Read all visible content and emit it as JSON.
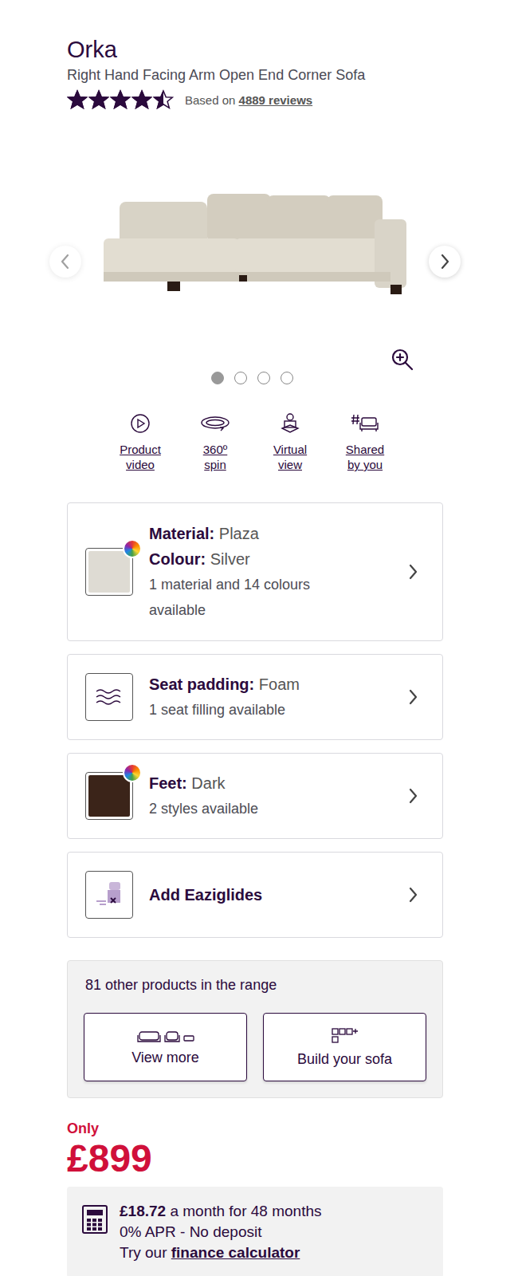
{
  "product": {
    "name": "Orka",
    "description": "Right Hand Facing Arm Open End Corner Sofa",
    "stars": 4.5,
    "reviews_prefix": "Based on",
    "reviews_link": "4889 reviews"
  },
  "gallery": {
    "slides": [
      {
        "selected": true
      },
      {
        "selected": false
      },
      {
        "selected": false
      },
      {
        "selected": false
      }
    ]
  },
  "media_links": [
    {
      "kind": "video",
      "lines": [
        "Product",
        "video"
      ]
    },
    {
      "kind": "spin",
      "lines": [
        "360º",
        "spin"
      ]
    },
    {
      "kind": "virtual",
      "lines": [
        "Virtual",
        "view"
      ]
    },
    {
      "kind": "shared",
      "lines": [
        "Shared",
        "by you"
      ]
    }
  ],
  "options": [
    {
      "kind": "swatch",
      "color": "#dedbd3",
      "fields": [
        {
          "label": "Material:",
          "value": "Plaza"
        },
        {
          "label": "Colour:",
          "value": "Silver"
        }
      ],
      "note": "1 material and 14 colours available"
    },
    {
      "kind": "padding",
      "fields": [
        {
          "label": "Seat padding:",
          "value": "Foam"
        }
      ],
      "note": "1 seat filling available"
    },
    {
      "kind": "swatch",
      "color": "#3b2419",
      "fields": [
        {
          "label": "Feet:",
          "value": "Dark"
        }
      ],
      "note": "2 styles available"
    },
    {
      "kind": "glides",
      "fields": [
        {
          "label": "Add Eaziglides",
          "value": ""
        }
      ],
      "note": ""
    }
  ],
  "range": {
    "text": "81 other products in the range",
    "buttons": [
      {
        "kind": "more",
        "label": "View more"
      },
      {
        "kind": "build",
        "label": "Build your sofa"
      }
    ]
  },
  "price": {
    "prefix": "Only",
    "amount": "£899"
  },
  "finance": {
    "amount": "£18.72",
    "rest": "a month for 48 months",
    "terms": "0% APR - No deposit",
    "prompt": "Try our",
    "link": "finance calculator"
  }
}
